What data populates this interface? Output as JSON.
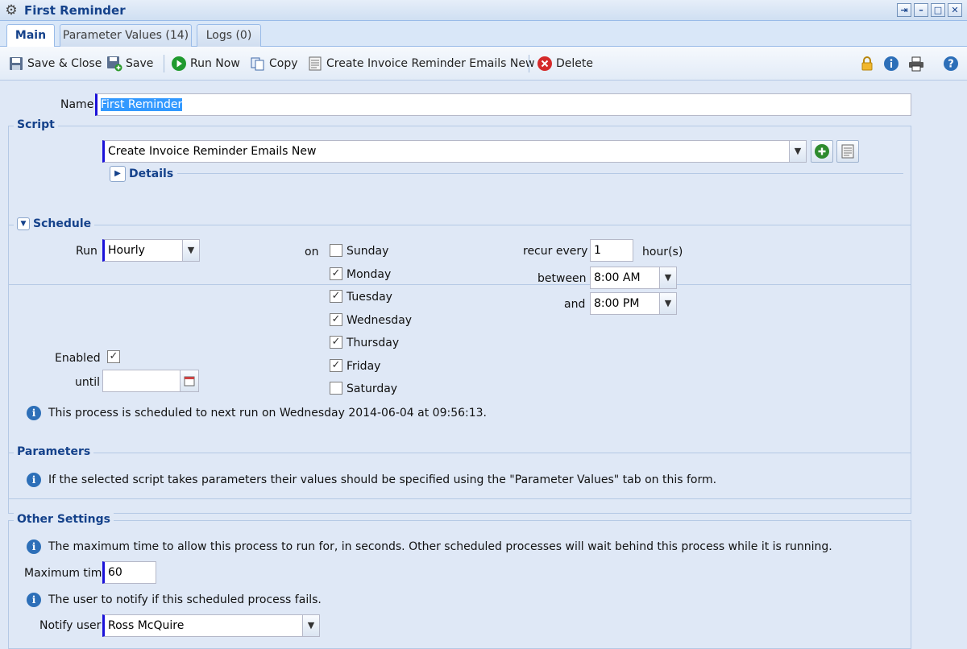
{
  "window": {
    "title": "First Reminder"
  },
  "tabs": [
    {
      "label": "Main"
    },
    {
      "label": "Parameter Values (14)"
    },
    {
      "label": "Logs (0)"
    }
  ],
  "toolbar": {
    "save_close": "Save & Close",
    "save": "Save",
    "run_now": "Run Now",
    "copy": "Copy",
    "create_invoice": "Create Invoice Reminder Emails New",
    "delete": "Delete"
  },
  "form": {
    "name_label": "Name",
    "name_value": "First Reminder",
    "script": {
      "legend": "Script",
      "value": "Create Invoice Reminder Emails New",
      "details_label": "Details"
    },
    "schedule": {
      "legend": "Schedule",
      "run_label": "Run",
      "run_value": "Hourly",
      "on_label": "on",
      "days": [
        {
          "label": "Sunday",
          "checked": false
        },
        {
          "label": "Monday",
          "checked": true
        },
        {
          "label": "Tuesday",
          "checked": true
        },
        {
          "label": "Wednesday",
          "checked": true
        },
        {
          "label": "Thursday",
          "checked": true
        },
        {
          "label": "Friday",
          "checked": true
        },
        {
          "label": "Saturday",
          "checked": false
        }
      ],
      "recur_label": "recur every",
      "recur_value": "1",
      "recur_unit": "hour(s)",
      "between_label": "between",
      "between_value": "8:00 AM",
      "and_label": "and",
      "and_value": "8:00 PM",
      "enabled_label": "Enabled",
      "enabled_checked": true,
      "until_label": "until",
      "until_value": "",
      "next_run_note": "This process is scheduled to next run on Wednesday 2014-06-04 at 09:56:13."
    },
    "parameters": {
      "legend": "Parameters",
      "note": "If the selected script takes parameters their values should be specified using the \"Parameter Values\" tab on this form."
    },
    "other": {
      "legend": "Other Settings",
      "max_time_note": "The maximum time to allow this process to run for, in seconds. Other scheduled processes will wait behind this process while it is running.",
      "max_time_label": "Maximum time",
      "max_time_value": "60",
      "notify_note": "The user to notify if this scheduled process fails.",
      "notify_label": "Notify user",
      "notify_value": "Ross McQuire"
    }
  }
}
